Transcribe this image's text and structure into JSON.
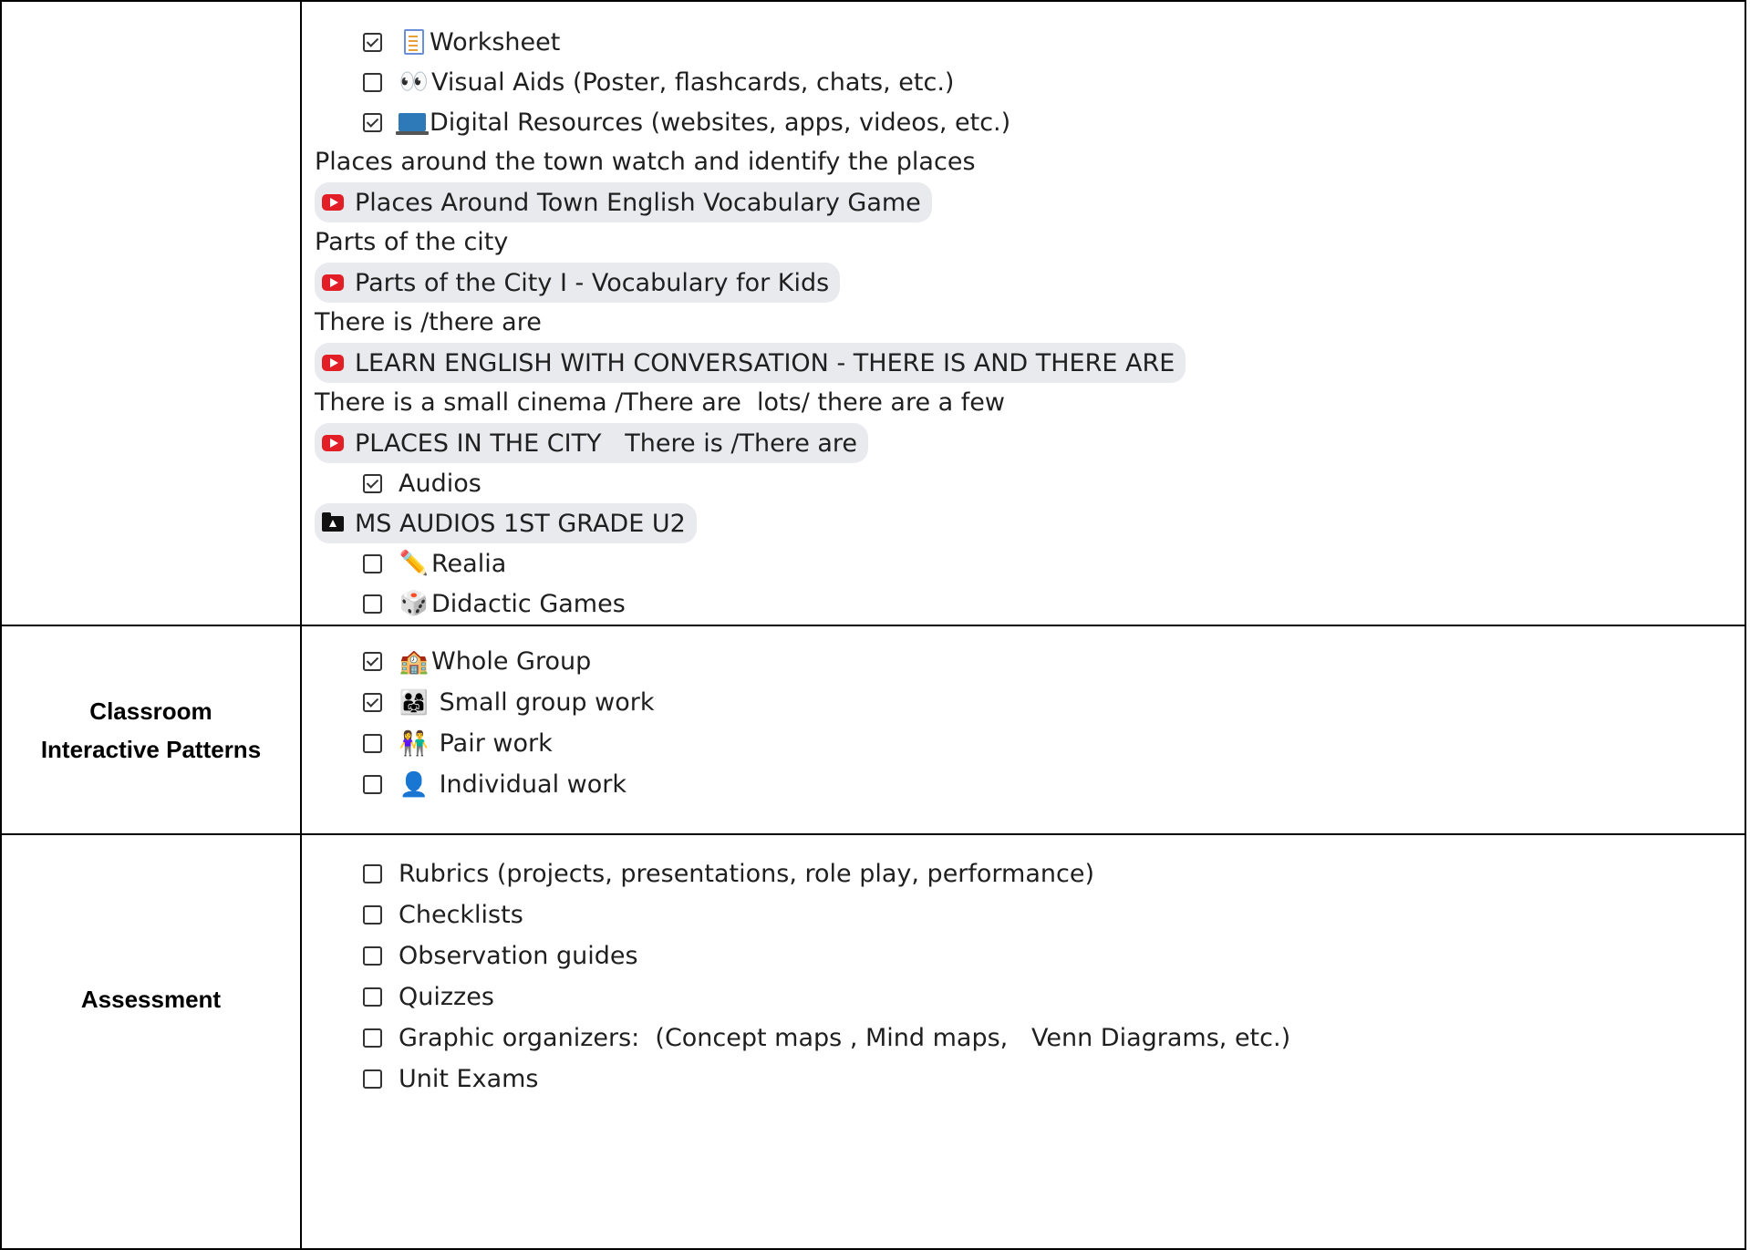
{
  "materials": {
    "items_top": [
      {
        "label": "Worksheet",
        "checked": true,
        "icon": "worksheet-icon"
      },
      {
        "label": "Visual Aids (Poster, flashcards, chats, etc.)",
        "checked": false,
        "icon": "eyes-icon"
      },
      {
        "label": "Digital Resources (websites, apps, videos, etc.)",
        "checked": true,
        "icon": "laptop-icon"
      }
    ],
    "note1": "Places around the town watch and identify the places",
    "link1": "Places Around Town English Vocabulary Game",
    "note2": "Parts of the city",
    "link2": "Parts of the City I - Vocabulary for Kids",
    "note3": "There is /there are",
    "link3": "LEARN ENGLISH WITH CONVERSATION - THERE IS AND THERE ARE",
    "note4": "There is a small cinema /There are  lots/ there are a few",
    "link4": "PLACES IN THE CITY   There is /There are",
    "audios": {
      "label": "Audios",
      "checked": true
    },
    "folder_link": "MS AUDIOS 1ST GRADE U2",
    "items_bottom": [
      {
        "label": "Realia",
        "checked": false,
        "icon": "pencil-icon"
      },
      {
        "label": "Didactic Games",
        "checked": false,
        "icon": "dice-icon"
      }
    ]
  },
  "interactive": {
    "label_line1": "Classroom",
    "label_line2": "Interactive Patterns",
    "items": [
      {
        "label": "Whole Group",
        "checked": true,
        "icon": "school-icon"
      },
      {
        "label": " Small group work",
        "checked": true,
        "icon": "family-icon"
      },
      {
        "label": " Pair work",
        "checked": false,
        "icon": "pair-icon"
      },
      {
        "label": " Individual work",
        "checked": false,
        "icon": "person-icon"
      }
    ]
  },
  "assessment": {
    "label": "Assessment",
    "items": [
      {
        "label": "Rubrics (projects, presentations, role play, performance)",
        "checked": false
      },
      {
        "label": "Checklists",
        "checked": false
      },
      {
        "label": "Observation guides",
        "checked": false
      },
      {
        "label": "Quizzes",
        "checked": false
      },
      {
        "label": "Graphic organizers:  (Concept maps , Mind maps,   Venn Diagrams, etc.)",
        "checked": false
      },
      {
        "label": "Unit Exams",
        "checked": false
      }
    ]
  },
  "colors": {
    "youtube": "#e21f26",
    "chip_bg": "#e9eaee",
    "border": "#000000"
  }
}
